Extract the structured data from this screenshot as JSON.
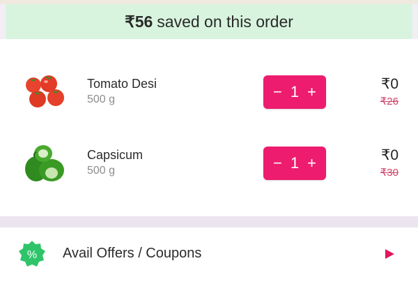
{
  "banner": {
    "amount": "₹56",
    "text": "saved on this order"
  },
  "cart": {
    "items": [
      {
        "name": "Tomato Desi",
        "quantity": "500 g",
        "minus": "−",
        "count": "1",
        "plus": "+",
        "price": "₹0",
        "mrp": "₹26",
        "image": "tomato-image"
      },
      {
        "name": "Capsicum",
        "quantity": "500 g",
        "minus": "−",
        "count": "1",
        "plus": "+",
        "price": "₹0",
        "mrp": "₹30",
        "image": "capsicum-image"
      }
    ]
  },
  "offers": {
    "label": "Avail Offers / Coupons",
    "badge_symbol": "%",
    "arrow_icon": "play-arrow-icon"
  },
  "colors": {
    "accent": "#ed1c6e",
    "banner_bg": "#d8f4de",
    "badge_green": "#2fc46a",
    "strike": "#d2456a"
  }
}
